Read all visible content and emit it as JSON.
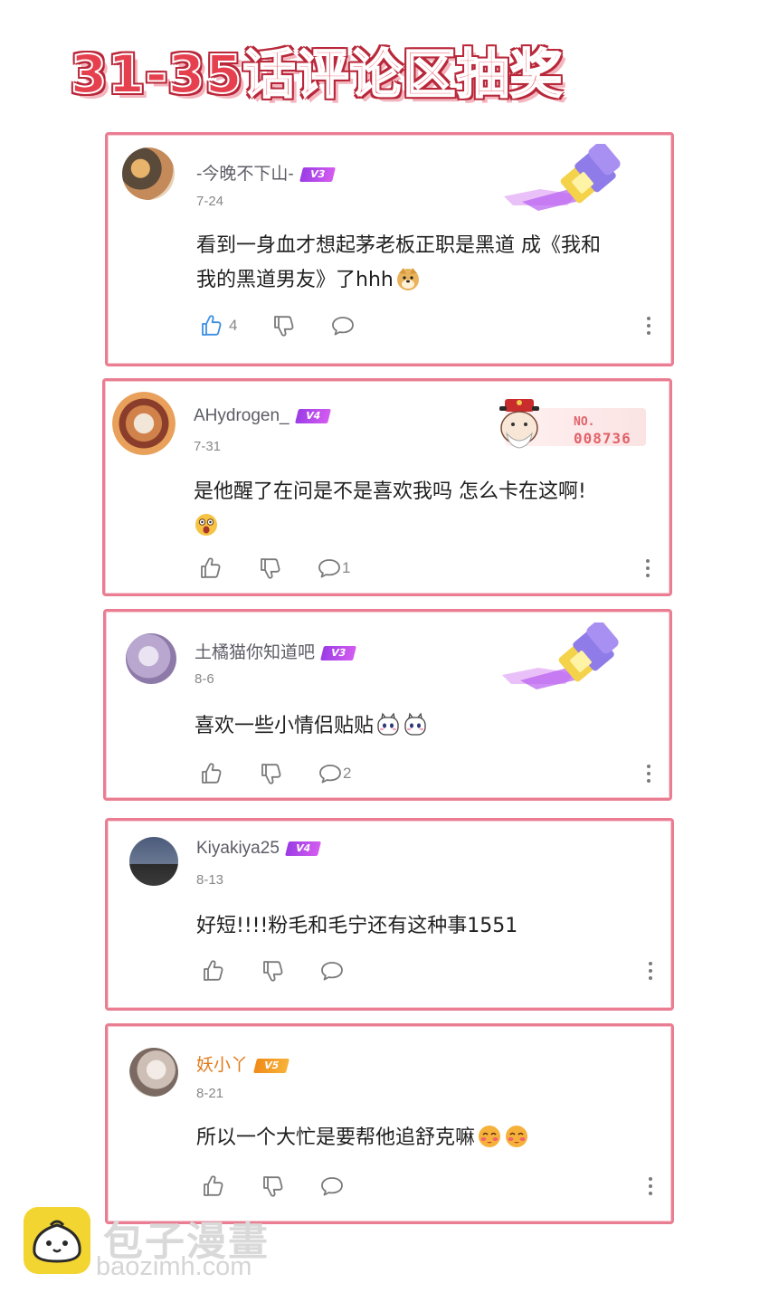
{
  "title": "31-35话评论区抽奖",
  "comments": [
    {
      "username": "-今晚不下山-",
      "level": "V3",
      "date": "7-24",
      "text_line1": "看到一身血才想起茅老板正职是黑道 成《我和",
      "text_line2": "我的黑道男友》了hhh",
      "likes": "4",
      "replies": "",
      "liked": true,
      "emoji": "doge-emoji"
    },
    {
      "username": "AHydrogen_",
      "level": "V4",
      "date": "7-31",
      "text_line1": "是他醒了在问是不是喜欢我吗 怎么卡在这啊!",
      "text_line2": "",
      "likes": "",
      "replies": "1",
      "badge_no_label": "NO.",
      "badge_no_value": "008736",
      "emoji": "shocked-emoji"
    },
    {
      "username": "土橘猫你知道吧",
      "level": "V3",
      "date": "8-6",
      "text_line1": "喜欢一些小情侣贴贴",
      "likes": "",
      "replies": "2",
      "emoji": "blushing-bunny-emoji"
    },
    {
      "username": "Kiyakiya25",
      "level": "V4",
      "date": "8-13",
      "text_line1": "好短!!!!粉毛和毛宁还有这种事1551",
      "likes": "",
      "replies": ""
    },
    {
      "username": "妖小丫",
      "level": "V5",
      "date": "8-21",
      "text_line1": "所以一个大忙是要帮他追舒克嘛",
      "likes": "",
      "replies": "",
      "emoji": "blushing-face-emoji"
    }
  ],
  "watermark": {
    "cn": "包子漫畫",
    "en": "baozimh.com"
  },
  "colors": {
    "card_border": "#ea7d92",
    "title_red": "#e6404f",
    "level_purple": "#a646e8",
    "level_orange": "#f29a22",
    "like_active": "#3b8fe0"
  }
}
